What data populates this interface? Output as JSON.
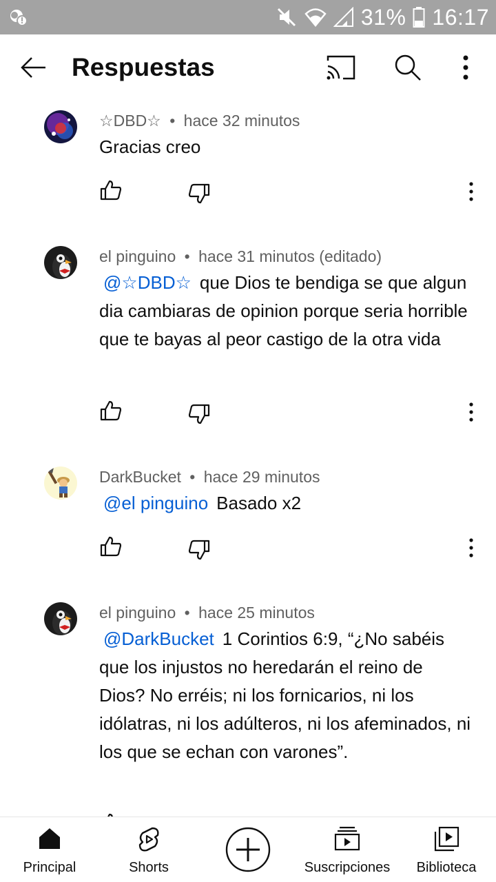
{
  "statusbar": {
    "battery": "31%",
    "time": "16:17",
    "icons": [
      "notification-icon",
      "mute-icon",
      "wifi-icon",
      "signal-icon",
      "battery-icon"
    ]
  },
  "header": {
    "title": "Respuestas",
    "icons": [
      "back-arrow-icon",
      "cast-icon",
      "search-icon",
      "more-vert-icon"
    ]
  },
  "comments": [
    {
      "author": "☆DBD☆",
      "time": "hace 32 minutos",
      "mention": "",
      "text": "Gracias creo"
    },
    {
      "author": "el pinguino",
      "time": "hace 31 minutos (editado)",
      "mention": "@☆DBD☆",
      "text": "que Dios te bendiga  se que algun dia cambiaras de opinion porque seria horrible que te bayas al peor castigo de la otra vida"
    },
    {
      "author": "DarkBucket",
      "time": "hace 29 minutos",
      "mention": "@el pinguino",
      "text": "Basado x2"
    },
    {
      "author": "el pinguino",
      "time": "hace 25 minutos",
      "mention": "@DarkBucket",
      "text": "1 Corintios 6:9, “¿No sabéis que los injustos no heredarán el reino de Dios? No erréis; ni los fornicarios, ni los idólatras, ni los adúlteros, ni los afeminados, ni los que se echan con varones”."
    }
  ],
  "meta_separator": "•",
  "nav": {
    "items": [
      {
        "label": "Principal",
        "icon": "home-icon"
      },
      {
        "label": "Shorts",
        "icon": "shorts-icon"
      },
      {
        "label": "",
        "icon": "create-icon"
      },
      {
        "label": "Suscripciones",
        "icon": "subscriptions-icon"
      },
      {
        "label": "Biblioteca",
        "icon": "library-icon"
      }
    ]
  },
  "colors": {
    "statusbar_bg": "#a3a3a3",
    "mention": "#065fd4",
    "meta": "#606060",
    "text": "#0f0f0f"
  }
}
